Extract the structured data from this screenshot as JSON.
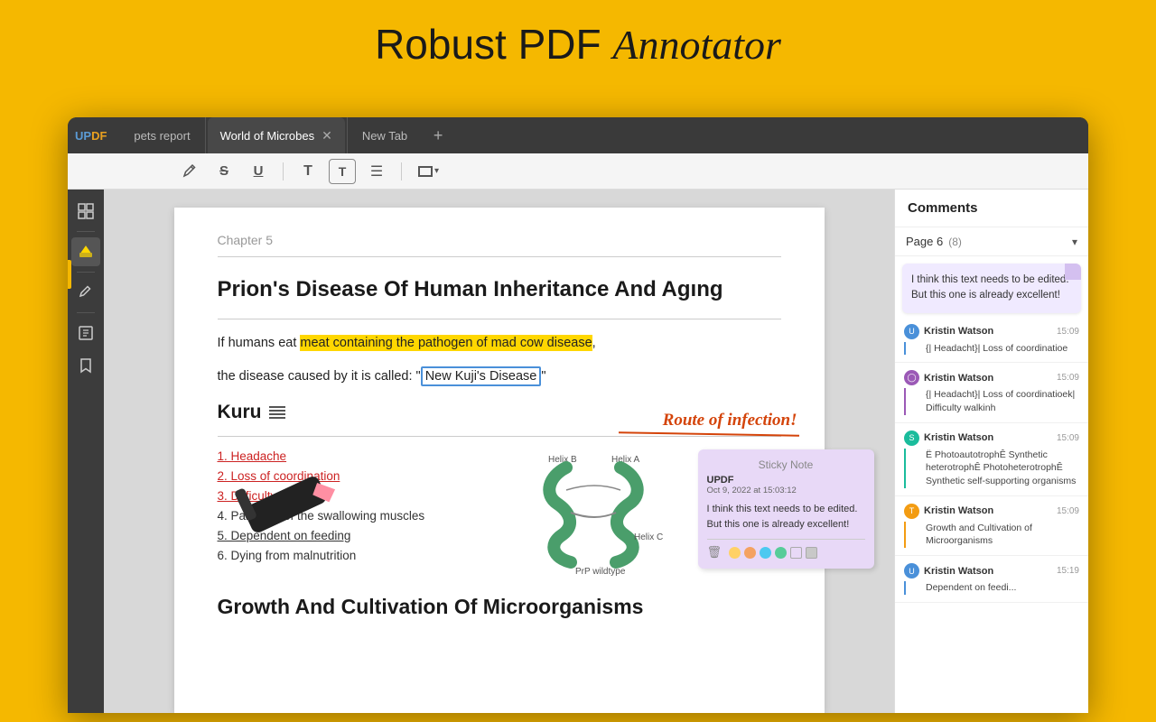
{
  "header": {
    "title_normal": "Robust PDF ",
    "title_cursive": "Annotator"
  },
  "tabs": [
    {
      "label": "pets report",
      "active": false,
      "closeable": false
    },
    {
      "label": "World of Microbes",
      "active": true,
      "closeable": true
    },
    {
      "label": "New Tab",
      "active": false,
      "closeable": false
    }
  ],
  "logo": {
    "up": "UP",
    "df": "DF"
  },
  "toolbar": {
    "buttons": [
      {
        "name": "pen-tool",
        "icon": "✒",
        "label": "Pen"
      },
      {
        "name": "strikethrough-tool",
        "icon": "S̶",
        "label": "Strikethrough"
      },
      {
        "name": "underline-tool",
        "icon": "U̲",
        "label": "Underline"
      },
      {
        "name": "text-tool",
        "icon": "T",
        "label": "Text"
      },
      {
        "name": "textbox-tool",
        "icon": "T⃞",
        "label": "Text Box"
      },
      {
        "name": "align-tool",
        "icon": "☰",
        "label": "Align"
      },
      {
        "name": "rect-tool",
        "icon": "▭",
        "label": "Rectangle"
      }
    ]
  },
  "sidebar": {
    "items": [
      {
        "name": "thumbnails",
        "icon": "⊞"
      },
      {
        "name": "separator1",
        "sep": true
      },
      {
        "name": "highlight",
        "icon": "◧",
        "active": true
      },
      {
        "name": "separator2",
        "sep": true
      },
      {
        "name": "annotate",
        "icon": "✏"
      },
      {
        "name": "separator3",
        "sep": true
      },
      {
        "name": "pages",
        "icon": "⊕"
      },
      {
        "name": "bookmarks",
        "icon": "🔖"
      }
    ]
  },
  "pdf": {
    "chapter": "Chapter 5",
    "title": "Prion's Disease Of Human Inheritance And Agıng",
    "body1": "If humans eat ",
    "highlight1": "meat containing the pathogen of mad cow disease",
    "body1b": ",",
    "body2": "the disease caused by it is called: \"",
    "highlight2": "New Kuji's Disease",
    "body2b": "\"",
    "annotation": "Route of infection!",
    "section": "Kuru",
    "list": [
      {
        "text": "1. Headache",
        "style": "red-underline"
      },
      {
        "text": "2. Loss of coordination",
        "style": "red-underline"
      },
      {
        "text": "3. Difficulty walking",
        "style": "red-underline"
      },
      {
        "text": "4. Paralysis of the swallowing muscles",
        "style": "normal"
      },
      {
        "text": "5. Dependent on feeding",
        "style": "underline"
      },
      {
        "text": "6. Dying from malnutrition",
        "style": "normal"
      }
    ],
    "sticky_note": {
      "app": "UPDF",
      "date": "Oct 9, 2022 at 15:03:12",
      "body": "I think this text needs to be edited. But this one is already excellent!",
      "colors": [
        "#FFD166",
        "#f4a261",
        "#e76f51",
        "#4CC9F0",
        "#57CC99",
        "#e0e0e0"
      ]
    },
    "diagram_labels": [
      "Helix B",
      "Helix A",
      "Helix C",
      "PrP wildtype"
    ],
    "bottom_title": "Growth And Cultivation Of Microorganisms"
  },
  "comments": {
    "title": "Comments",
    "page": "Page 6",
    "count": "(8)",
    "active_comment": "I think this text needs to be edited. But this one is already excellent!",
    "items": [
      {
        "author": "Kristin Watson",
        "time": "15:09",
        "avatar_type": "U",
        "avatar_color": "av-blue",
        "body": "{| Headacht}| Loss of coordinatioe",
        "border_color": "blue"
      },
      {
        "author": "Kristin Watson",
        "time": "15:09",
        "avatar_type": "◯",
        "avatar_color": "av-purple",
        "body": "{| Headacht}| Loss of coordinatioek| Difficulty walkinh",
        "border_color": "purple"
      },
      {
        "author": "Kristin Watson",
        "time": "15:09",
        "avatar_type": "S",
        "avatar_color": "av-teal",
        "body": "Ë PhotoautotrophÊ Synthetic heterotrophÊ PhotoheterotrophÊ Synthetic self-supporting organisms",
        "border_color": "teal"
      },
      {
        "author": "Kristin Watson",
        "time": "15:09",
        "avatar_type": "T",
        "avatar_color": "av-gold",
        "body": "Growth and Cultivation of Microorganisms",
        "border_color": "gold"
      },
      {
        "author": "Kristin Watson",
        "time": "15:19",
        "avatar_type": "U",
        "avatar_color": "av-blue",
        "body": "Dependent on feedi...",
        "border_color": "blue"
      }
    ]
  }
}
